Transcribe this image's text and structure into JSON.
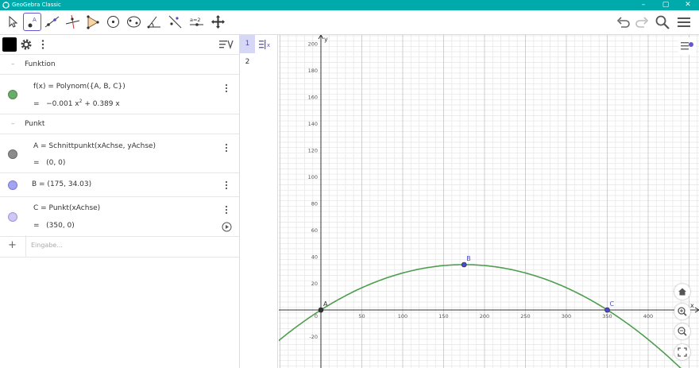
{
  "window": {
    "title": "GeoGebra Classic"
  },
  "toolbar": {
    "tools": [
      {
        "icon": "move-icon",
        "name": "tool-move"
      },
      {
        "icon": "point-icon",
        "name": "tool-point",
        "active": true
      },
      {
        "icon": "line-icon",
        "name": "tool-line"
      },
      {
        "icon": "perpendicular-icon",
        "name": "tool-perpendicular"
      },
      {
        "icon": "polygon-icon",
        "name": "tool-polygon"
      },
      {
        "icon": "circle-icon",
        "name": "tool-circle"
      },
      {
        "icon": "conic-icon",
        "name": "tool-conic"
      },
      {
        "icon": "angle-icon",
        "name": "tool-angle"
      },
      {
        "icon": "reflect-icon",
        "name": "tool-reflect"
      },
      {
        "icon": "slider-icon",
        "name": "tool-slider",
        "label": "a=2"
      },
      {
        "icon": "move-view-icon",
        "name": "tool-move-graphics"
      }
    ],
    "right_icons": [
      "undo-icon",
      "redo-icon",
      "search-icon",
      "menu-icon"
    ]
  },
  "algebra": {
    "groups": [
      {
        "label": "Funktion"
      },
      {
        "label": "Punkt"
      }
    ],
    "objects": [
      {
        "name": "f",
        "definition": "f(x)  =  Polynom({A, B, C})",
        "value_prefix": "=",
        "value": "−0.001 x",
        "value_exp": "2",
        "value_rest": " + 0.389 x",
        "color": "#6aaa6a"
      },
      {
        "name": "A",
        "definition": "A  =  Schnittpunkt(xAchse, yAchse)",
        "value_prefix": "=",
        "value": "(0, 0)",
        "color": "#888888"
      },
      {
        "name": "B",
        "definition": "B  =  (175, 34.03)",
        "color": "#a3a3f0"
      },
      {
        "name": "C",
        "definition": "C  =  Punkt(xAchse)",
        "value_prefix": "=",
        "value": "(350, 0)",
        "color": "#c8c4f0"
      }
    ],
    "input_placeholder": "Eingabe..."
  },
  "spreadsheet": {
    "rows": [
      "1",
      "2"
    ]
  },
  "graphics": {
    "x_axis_label": "x",
    "y_axis_label": "y",
    "x_ticks": [
      "0",
      "50",
      "100",
      "150",
      "200",
      "250",
      "300",
      "350",
      "400"
    ],
    "y_ticks": [
      "-20",
      "20",
      "40",
      "60",
      "80",
      "100",
      "120",
      "140",
      "160",
      "180",
      "200"
    ],
    "curve_color": "#4f9d4f",
    "points": [
      {
        "label": "A",
        "x": 0,
        "y": 0,
        "color": "#333333"
      },
      {
        "label": "B",
        "x": 175,
        "y": 34.03,
        "color": "#4b4bc8"
      },
      {
        "label": "C",
        "x": 350,
        "y": 0,
        "color": "#4b4bc8"
      }
    ],
    "coef_a": -0.001111,
    "coef_b": 0.389
  }
}
